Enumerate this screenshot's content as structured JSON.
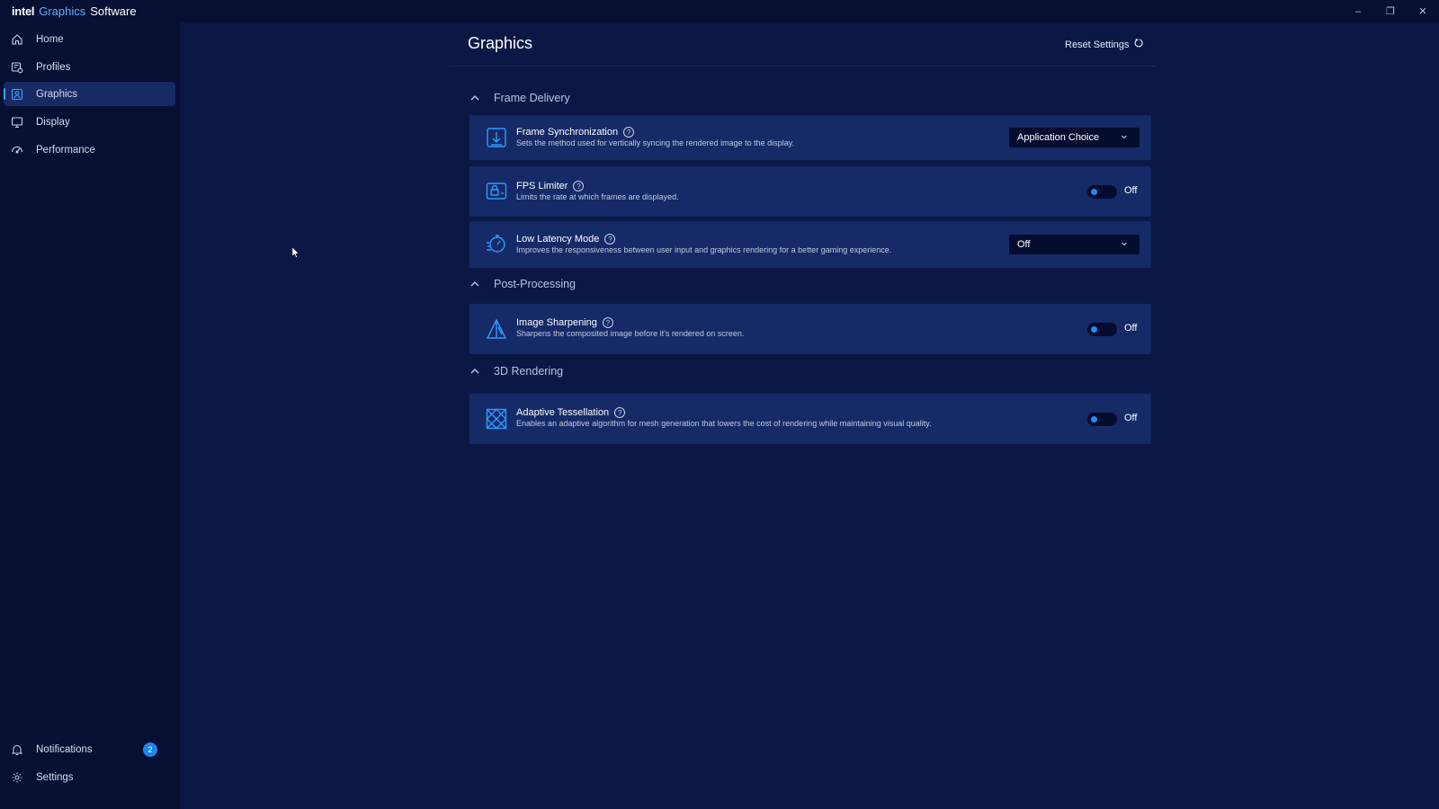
{
  "app": {
    "brand_intel": "intel",
    "brand_graphics": "Graphics",
    "brand_software": "Software",
    "window_controls": [
      "–",
      "❐",
      "✕"
    ]
  },
  "sidebar": {
    "items": [
      {
        "label": "Home",
        "icon": "home-icon"
      },
      {
        "label": "Profiles",
        "icon": "profiles-icon"
      },
      {
        "label": "Graphics",
        "icon": "graphics-icon",
        "active": true
      },
      {
        "label": "Display",
        "icon": "display-icon"
      },
      {
        "label": "Performance",
        "icon": "performance-icon"
      }
    ],
    "bottom": {
      "notifications_label": "Notifications",
      "notifications_count": "2",
      "settings_label": "Settings"
    }
  },
  "header": {
    "title": "Graphics",
    "reset_label": "Reset Settings"
  },
  "sections": {
    "frame_delivery": {
      "title": "Frame Delivery",
      "frame_sync": {
        "title": "Frame Synchronization",
        "desc": "Sets the method used for vertically syncing the rendered image to the display.",
        "value": "Application Choice"
      },
      "fps_limiter": {
        "title": "FPS Limiter",
        "desc": "Limits the rate at which frames are displayed.",
        "state": "Off"
      },
      "low_latency": {
        "title": "Low Latency Mode",
        "desc": "Improves the responsiveness between user input and graphics rendering for a better gaming experience.",
        "value": "Off"
      }
    },
    "post_processing": {
      "title": "Post-Processing",
      "sharpening": {
        "title": "Image Sharpening",
        "desc": "Sharpens the composited image before it's rendered on screen.",
        "state": "Off"
      }
    },
    "rendering_3d": {
      "title": "3D Rendering",
      "tessellation": {
        "title": "Adaptive Tessellation",
        "desc": "Enables an adaptive algorithm for mesh generation that lowers the cost of rendering while maintaining visual quality.",
        "state": "Off"
      }
    }
  },
  "help_glyph": "?",
  "colors": {
    "background": "#0b1845",
    "sidebar": "#071033",
    "card": "#152a66",
    "accent": "#1d8cf8"
  }
}
